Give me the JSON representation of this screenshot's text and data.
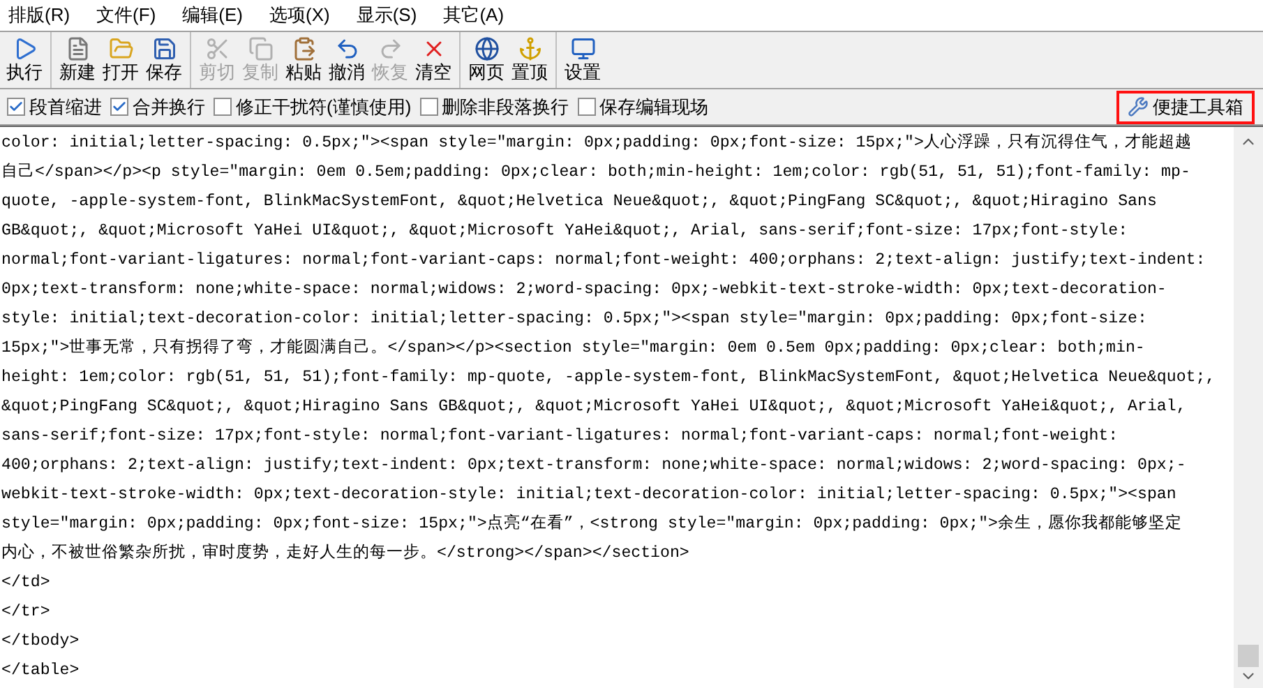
{
  "menu": [
    "排版(R)",
    "文件(F)",
    "编辑(E)",
    "选项(X)",
    "显示(S)",
    "其它(A)"
  ],
  "toolbar": [
    [
      {
        "label": "执行",
        "disabled": false
      }
    ],
    [
      {
        "label": "新建",
        "disabled": false
      },
      {
        "label": "打开",
        "disabled": false
      },
      {
        "label": "保存",
        "disabled": false
      }
    ],
    [
      {
        "label": "剪切",
        "disabled": true
      },
      {
        "label": "复制",
        "disabled": true
      },
      {
        "label": "粘贴",
        "disabled": false
      },
      {
        "label": "撤消",
        "disabled": false
      },
      {
        "label": "恢复",
        "disabled": true
      },
      {
        "label": "清空",
        "disabled": false
      }
    ],
    [
      {
        "label": "网页",
        "disabled": false
      },
      {
        "label": "置顶",
        "disabled": false
      }
    ],
    [
      {
        "label": "设置",
        "disabled": false
      }
    ]
  ],
  "options": [
    {
      "label": "段首缩进",
      "checked": true
    },
    {
      "label": "合并换行",
      "checked": true
    },
    {
      "label": "修正干扰符(谨慎使用)",
      "checked": false
    },
    {
      "label": "删除非段落换行",
      "checked": false
    },
    {
      "label": "保存编辑现场",
      "checked": false
    }
  ],
  "toolbox_button": "便捷工具箱",
  "editor_lines": [
    "color: initial;letter-spacing: 0.5px;\"><span style=\"margin: 0px;padding: 0px;font-size: 15px;\">人心浮躁，只有沉得住气，才能超越",
    "自己</span></p><p style=\"margin: 0em 0.5em;padding: 0px;clear: both;min-height: 1em;color: rgb(51, 51, 51);font-family: mp-",
    "quote, -apple-system-font, BlinkMacSystemFont, &quot;Helvetica Neue&quot;, &quot;PingFang SC&quot;, &quot;Hiragino Sans",
    "GB&quot;, &quot;Microsoft YaHei UI&quot;, &quot;Microsoft YaHei&quot;, Arial, sans-serif;font-size: 17px;font-style:",
    "normal;font-variant-ligatures: normal;font-variant-caps: normal;font-weight: 400;orphans: 2;text-align: justify;text-indent:",
    "0px;text-transform: none;white-space: normal;widows: 2;word-spacing: 0px;-webkit-text-stroke-width: 0px;text-decoration-",
    "style: initial;text-decoration-color: initial;letter-spacing: 0.5px;\"><span style=\"margin: 0px;padding: 0px;font-size:",
    "15px;\">世事无常，只有拐得了弯，才能圆满自己。</span></p><section style=\"margin: 0em 0.5em 0px;padding: 0px;clear: both;min-",
    "height: 1em;color: rgb(51, 51, 51);font-family: mp-quote, -apple-system-font, BlinkMacSystemFont, &quot;Helvetica Neue&quot;,",
    "&quot;PingFang SC&quot;, &quot;Hiragino Sans GB&quot;, &quot;Microsoft YaHei UI&quot;, &quot;Microsoft YaHei&quot;, Arial,",
    "sans-serif;font-size: 17px;font-style: normal;font-variant-ligatures: normal;font-variant-caps: normal;font-weight:",
    "400;orphans: 2;text-align: justify;text-indent: 0px;text-transform: none;white-space: normal;widows: 2;word-spacing: 0px;-",
    "webkit-text-stroke-width: 0px;text-decoration-style: initial;text-decoration-color: initial;letter-spacing: 0.5px;\"><span",
    "style=\"margin: 0px;padding: 0px;font-size: 15px;\">点亮“在看”，<strong style=\"margin: 0px;padding: 0px;\">余生，愿你我都能够坚定",
    "内心，不被世俗繁杂所扰，审时度势，走好人生的每一步。</strong></span></section>",
    "</td>",
    "</tr>",
    "</tbody>",
    "</table>"
  ]
}
